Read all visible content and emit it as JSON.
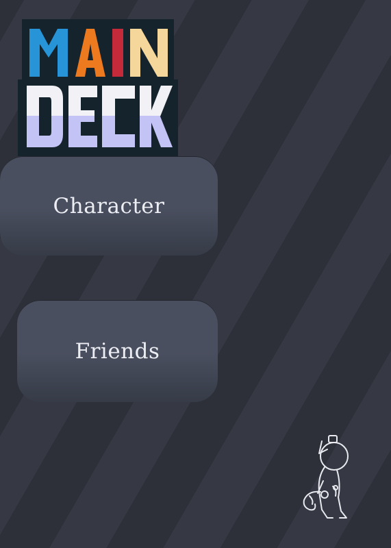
{
  "logo": {
    "line1": [
      "M",
      "A",
      "I",
      "N"
    ],
    "line2": "DECK",
    "colors": {
      "m": "#2794d8",
      "a": "#ee7a1f",
      "i": "#c42a3a",
      "n": "#f5d79b",
      "deck_top": "#f1f1f6",
      "deck_bottom": "#c4c3f6",
      "background": "#15232c"
    }
  },
  "menu": {
    "character_label": "Character",
    "friends_label": "Friends"
  },
  "colors": {
    "background_dark": "#2d3038",
    "background_light": "#363944",
    "button_top": "#4a4f5f",
    "button_bottom": "#363b47",
    "button_text": "#eceef4"
  },
  "mascot": {
    "icon": "cat-doodle-icon"
  }
}
